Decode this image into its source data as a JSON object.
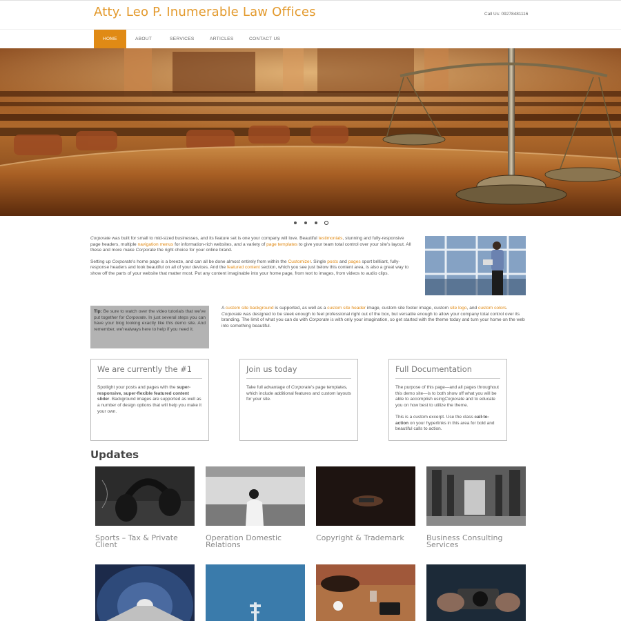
{
  "header": {
    "site_title": "Atty. Leo P. Inumerable Law Offices",
    "call_us": "Call Us: 09278481116"
  },
  "nav": {
    "items": [
      {
        "label": "HOME",
        "active": true
      },
      {
        "label": "ABOUT",
        "active": false
      },
      {
        "label": "SERVICES",
        "active": false
      },
      {
        "label": "ARTICLES",
        "active": false
      },
      {
        "label": "CONTACT US",
        "active": false
      }
    ]
  },
  "slider": {
    "slide_count": 4,
    "active_slide": 4
  },
  "intro": {
    "p1": [
      {
        "t": "Corporate",
        "s": "i"
      },
      {
        "t": " was built for small to mid-sized businesses, and its feature set is one your company will love. Beautiful "
      },
      {
        "t": "testimonials",
        "s": "link"
      },
      {
        "t": ", stunning and fully-responsive page headers, multiple "
      },
      {
        "t": "navigation menus",
        "s": "link"
      },
      {
        "t": " for information-rich websites, and a variety of "
      },
      {
        "t": "page templates",
        "s": "link"
      },
      {
        "t": " to give your team total control over your site's layout. All these and more make "
      },
      {
        "t": "Corporate",
        "s": "i"
      },
      {
        "t": " the right choice for your online brand."
      }
    ],
    "p2": [
      {
        "t": "Setting up "
      },
      {
        "t": "Corporate",
        "s": "i"
      },
      {
        "t": "'s home page is a breeze, and can all be done almost entirely from within the "
      },
      {
        "t": "Customizer",
        "s": "link"
      },
      {
        "t": ". Single "
      },
      {
        "t": "posts",
        "s": "link"
      },
      {
        "t": " and "
      },
      {
        "t": "pages",
        "s": "link"
      },
      {
        "t": " sport brilliant, fully-response headers and look beautiful on all of your devices. And the "
      },
      {
        "t": "featured content",
        "s": "link"
      },
      {
        "t": " section, which you see just below this content area, is also a great way to show off the parts of your website that matter most. Put any content imaginable into your home page, from text to images, from videos to audio clips."
      }
    ]
  },
  "tip": [
    {
      "t": "Tip:",
      "s": "b"
    },
    {
      "t": " Be sure to watch over the video tutorials that we've put together for "
    },
    {
      "t": "Corporate",
      "s": "i"
    },
    {
      "t": ". In just several steps you can have your blog looking exactly like this demo site. And remember, we'realways here to help if you need it."
    }
  ],
  "custom_text": [
    {
      "t": "A "
    },
    {
      "t": "custom site background",
      "s": "link"
    },
    {
      "t": " is supported, as well as a "
    },
    {
      "t": "custom site header",
      "s": "link"
    },
    {
      "t": " image, custom site footer image, custom "
    },
    {
      "t": "site logo",
      "s": "link"
    },
    {
      "t": ", and "
    },
    {
      "t": "custom colors",
      "s": "link"
    },
    {
      "t": ". "
    },
    {
      "t": "Corporate",
      "s": "i"
    },
    {
      "t": " was designed to be sleek enough to feel professional right out of the box, but versatile enough to allow your company total control over its branding. The limit of what you can do with "
    },
    {
      "t": "Corporate",
      "s": "i"
    },
    {
      "t": " is with only your imagination, so get started with the theme today and turn your home on the web into something beautiful."
    }
  ],
  "boxes": [
    {
      "title": "We are currently the #1",
      "paras": [
        [
          {
            "t": "Spotlight your posts and pages with the "
          },
          {
            "t": "super-responsive, super-flexible featured content slider",
            "s": "b"
          },
          {
            "t": ". Background images are supported as well as a number of design options that will help you make it your own."
          }
        ]
      ]
    },
    {
      "title": "Join us today",
      "paras": [
        [
          {
            "t": "Take full advantage of "
          },
          {
            "t": "Corporate",
            "s": "i"
          },
          {
            "t": "'s page templates, which include additional features and custom layouts for your site."
          }
        ]
      ]
    },
    {
      "title": "Full Documentation",
      "paras": [
        [
          {
            "t": "The purpose of this page—and all pages throughout this demo site—is to both show off what you will be able to accomplish using"
          },
          {
            "t": "Corporate",
            "s": "i"
          },
          {
            "t": " and to educate you on how best to utilize the theme."
          }
        ],
        [
          {
            "t": "This is a custom excerpt. Use the class "
          },
          {
            "t": "call-to-action",
            "s": "b"
          },
          {
            "t": " on your hyperlinks in this area for bold and beautiful calls to action."
          }
        ]
      ]
    }
  ],
  "updates": {
    "heading": "Updates",
    "cards": [
      {
        "title": "Sports – Tax & Private Client"
      },
      {
        "title": "Operation Domestic Relations"
      },
      {
        "title": "Copyright & Trademark"
      },
      {
        "title": "Business Consulting Services"
      }
    ]
  },
  "colors": {
    "accent": "#e08a15",
    "title_orange": "#e39a2d",
    "tip_bg": "#b3b3b3"
  }
}
